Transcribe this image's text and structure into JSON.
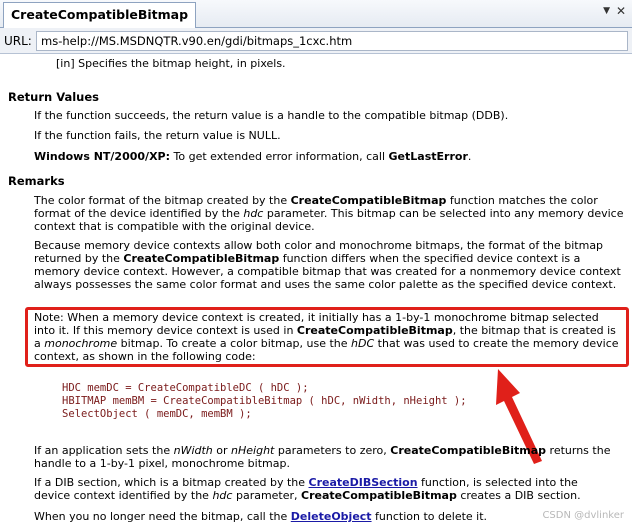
{
  "tab": {
    "title": "CreateCompatibleBitmap"
  },
  "url": {
    "label": "URL:",
    "value": "ms-help://MS.MSDNQTR.v90.en/gdi/bitmaps_1cxc.htm"
  },
  "param": {
    "text": "[in] Specifies the bitmap height, in pixels."
  },
  "return_values": {
    "heading": "Return Values",
    "success": "If the function succeeds, the return value is a handle to the compatible bitmap (DDB).",
    "failure": "If the function fails, the return value is NULL.",
    "nt_label": "Windows NT/2000/XP:",
    "nt_text": " To get extended error information, call ",
    "nt_func": "GetLastError",
    "nt_end": "."
  },
  "remarks": {
    "heading": "Remarks",
    "p1_a": "The color format of the bitmap created by the ",
    "p1_b": "CreateCompatibleBitmap",
    "p1_c": " function matches the color format of the device identified by the ",
    "p1_d": "hdc",
    "p1_e": " parameter. This bitmap can be selected into any memory device context that is compatible with the original device.",
    "p2_a": "Because memory device contexts allow both color and monochrome bitmaps, the format of the bitmap returned by the ",
    "p2_b": "CreateCompatibleBitmap",
    "p2_c": " function differs when the specified device context is a memory device context. However, a compatible bitmap that was created for a nonmemory device context always possesses the same color format and uses the same color palette as the specified device context.",
    "note_a": "Note: When a memory device context is created, it initially has a 1-by-1 monochrome bitmap selected into it. If this memory device context is used in ",
    "note_b": "CreateCompatibleBitmap",
    "note_c": ", the bitmap that is created is a ",
    "note_d": "monochrome",
    "note_e": " bitmap. To create a color bitmap, use the ",
    "note_f": "hDC",
    "note_g": " that was used to create the memory device context, as shown in the following code:",
    "code": [
      "HDC memDC = CreateCompatibleDC ( hDC );",
      "HBITMAP memBM = CreateCompatibleBitmap ( hDC, nWidth, nHeight );",
      "SelectObject ( memDC, memBM );"
    ],
    "p3_a": "If an application sets the ",
    "p3_b": "nWidth",
    "p3_c": " or ",
    "p3_d": "nHeight",
    "p3_e": " parameters to zero, ",
    "p3_f": "CreateCompatibleBitmap",
    "p3_g": " returns the handle to a 1-by-1 pixel, monochrome bitmap.",
    "p4_a": "If a DIB section, which is a bitmap created by the ",
    "p4_b": "CreateDIBSection",
    "p4_c": " function, is selected into the device context identified by the ",
    "p4_d": "hdc",
    "p4_e": " parameter, ",
    "p4_f": "CreateCompatibleBitmap",
    "p4_g": " creates a DIB section.",
    "p5_a": "When you no longer need the bitmap, call the ",
    "p5_b": "DeleteObject",
    "p5_c": " function to delete it."
  },
  "watermark": "CSDN @dvlinker",
  "colors": {
    "highlight_box": "#e0201a",
    "link": "#1a1aa6"
  }
}
